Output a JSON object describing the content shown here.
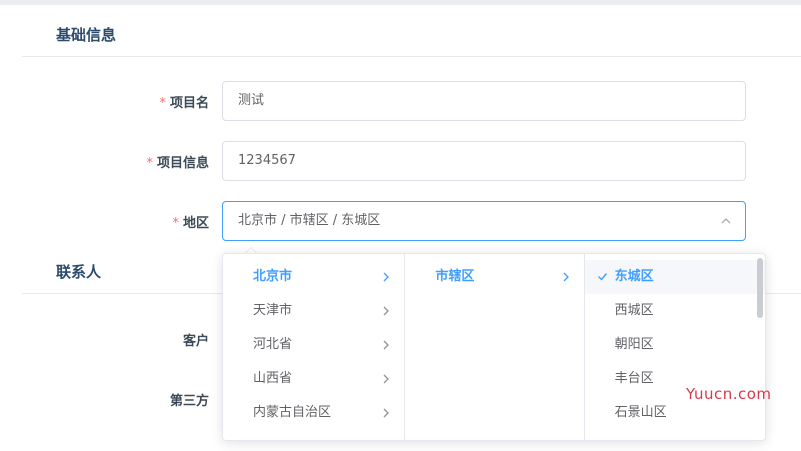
{
  "sections": {
    "basic": "基础信息",
    "contact": "联系人"
  },
  "form": {
    "required_mark": "*",
    "project_name": {
      "label": "项目名",
      "value": "测试"
    },
    "project_info": {
      "label": "项目信息",
      "value": "1234567"
    },
    "region": {
      "label": "地区",
      "value": "北京市 / 市辖区 / 东城区"
    },
    "customer": {
      "label": "客户"
    },
    "third_party": {
      "label": "第三方"
    }
  },
  "cascader": {
    "provinces": [
      "北京市",
      "天津市",
      "河北省",
      "山西省",
      "内蒙古自治区"
    ],
    "cities": [
      "市辖区"
    ],
    "districts": [
      "东城区",
      "西城区",
      "朝阳区",
      "丰台区",
      "石景山区"
    ]
  },
  "watermark": "Yuucn.com",
  "colors": {
    "accent": "#409eff",
    "required": "#f56c6c",
    "watermark": "#d83a4b"
  }
}
